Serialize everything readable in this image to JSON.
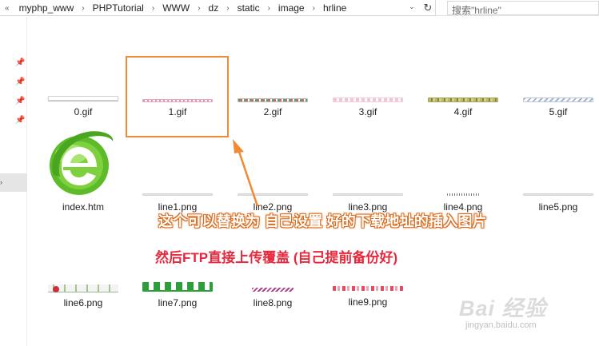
{
  "address": {
    "back_glyph": "«",
    "crumbs": [
      "myphp_www",
      "PHPTutorial",
      "WWW",
      "dz",
      "static",
      "image",
      "hrline"
    ],
    "separator_glyph": "›",
    "dropdown_glyph": "⌄",
    "refresh_glyph": "↻",
    "search_placeholder": "搜索\"hrline\""
  },
  "nav": {
    "pin_glyph": "📌",
    "selected_glyph": "›"
  },
  "files": [
    {
      "name": "0.gif",
      "thumb": "plain-line"
    },
    {
      "name": "1.gif",
      "thumb": "pink-dotted-line"
    },
    {
      "name": "2.gif",
      "thumb": "green-pink-beads"
    },
    {
      "name": "3.gif",
      "thumb": "pink-lace"
    },
    {
      "name": "4.gif",
      "thumb": "gold-vine"
    },
    {
      "name": "5.gif",
      "thumb": "blue-dashes"
    },
    {
      "name": "index.htm",
      "thumb": "browser-e-logo"
    },
    {
      "name": "line1.png",
      "thumb": "gray-line"
    },
    {
      "name": "line2.png",
      "thumb": "gray-line"
    },
    {
      "name": "line3.png",
      "thumb": "gray-line"
    },
    {
      "name": "line4.png",
      "thumb": "dotted-line"
    },
    {
      "name": "line5.png",
      "thumb": "gray-line"
    },
    {
      "name": "line6.png",
      "thumb": "red-flower-vine"
    },
    {
      "name": "line7.png",
      "thumb": "green-clovers"
    },
    {
      "name": "line8.png",
      "thumb": "purple-zigzag"
    },
    {
      "name": "line9.png",
      "thumb": "red-hearts"
    }
  ],
  "annotations": {
    "replace_note": "这个可以替换为 自己设置 好的下载地址的插入图片",
    "ftp_note": "然后FTP直接上传覆盖 (自己提前备份好)"
  },
  "watermark": {
    "brand": "Bai 经验",
    "url": "jingyan.baidu.com"
  },
  "colors": {
    "highlight_box": "#f08a35",
    "note_outline": "#d86a1a",
    "note_red": "#e8283c",
    "logo_green": "#5dbb2a"
  }
}
